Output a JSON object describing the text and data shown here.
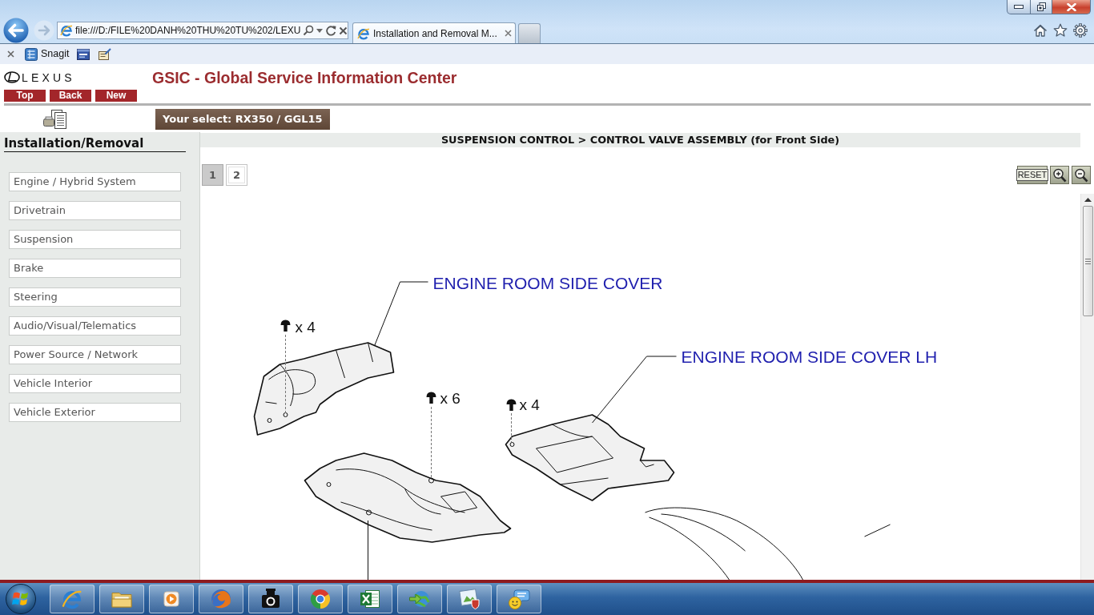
{
  "browser": {
    "address": "file:///D:/FILE%20DANH%20THU%20TU%202/LEXU",
    "tabs": [
      {
        "title": "Installation and Removal M...",
        "selected": true
      }
    ],
    "toolbar": [
      {
        "label": "Snagit"
      }
    ]
  },
  "header": {
    "brand": "LEXUS",
    "title": "GSIC - Global Service Information Center",
    "buttons": [
      "Top",
      "Back",
      "New"
    ],
    "selection": "Your select: RX350 / GGL15"
  },
  "sidebar": {
    "heading": "Installation/Removal",
    "items": [
      {
        "label": "Engine / Hybrid System",
        "selected": false
      },
      {
        "label": "Drivetrain",
        "selected": false
      },
      {
        "label": "Suspension",
        "selected": false
      },
      {
        "label": "Brake",
        "selected": false
      },
      {
        "label": "Steering",
        "selected": false
      },
      {
        "label": "Audio/Visual/Telematics",
        "selected": false
      },
      {
        "label": "Power Source / Network",
        "selected": false
      },
      {
        "label": "Vehicle Interior",
        "selected": false
      },
      {
        "label": "Vehicle Exterior",
        "selected": false
      }
    ]
  },
  "content": {
    "breadcrumb": "SUSPENSION CONTROL > CONTROL VALVE ASSEMBLY (for Front Side)",
    "pages": [
      {
        "label": "1",
        "selected": true
      },
      {
        "label": "2",
        "selected": false
      }
    ],
    "reset_button": "RESET",
    "diagram": {
      "callouts": [
        "ENGINE ROOM SIDE COVER",
        "ENGINE ROOM SIDE COVER LH"
      ],
      "fastener_counts": [
        "x 4",
        "x 6",
        "x 4"
      ]
    }
  }
}
